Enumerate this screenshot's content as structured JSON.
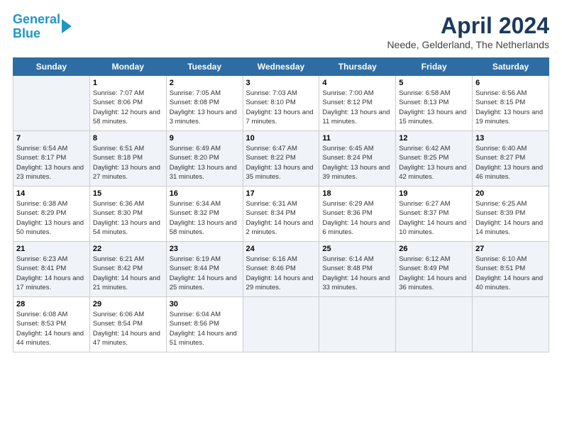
{
  "header": {
    "logo_line1": "General",
    "logo_line2": "Blue",
    "month_title": "April 2024",
    "location": "Neede, Gelderland, The Netherlands"
  },
  "days_of_week": [
    "Sunday",
    "Monday",
    "Tuesday",
    "Wednesday",
    "Thursday",
    "Friday",
    "Saturday"
  ],
  "weeks": [
    [
      {
        "num": "",
        "sunrise": "",
        "sunset": "",
        "daylight": ""
      },
      {
        "num": "1",
        "sunrise": "Sunrise: 7:07 AM",
        "sunset": "Sunset: 8:06 PM",
        "daylight": "Daylight: 12 hours and 58 minutes."
      },
      {
        "num": "2",
        "sunrise": "Sunrise: 7:05 AM",
        "sunset": "Sunset: 8:08 PM",
        "daylight": "Daylight: 13 hours and 3 minutes."
      },
      {
        "num": "3",
        "sunrise": "Sunrise: 7:03 AM",
        "sunset": "Sunset: 8:10 PM",
        "daylight": "Daylight: 13 hours and 7 minutes."
      },
      {
        "num": "4",
        "sunrise": "Sunrise: 7:00 AM",
        "sunset": "Sunset: 8:12 PM",
        "daylight": "Daylight: 13 hours and 11 minutes."
      },
      {
        "num": "5",
        "sunrise": "Sunrise: 6:58 AM",
        "sunset": "Sunset: 8:13 PM",
        "daylight": "Daylight: 13 hours and 15 minutes."
      },
      {
        "num": "6",
        "sunrise": "Sunrise: 6:56 AM",
        "sunset": "Sunset: 8:15 PM",
        "daylight": "Daylight: 13 hours and 19 minutes."
      }
    ],
    [
      {
        "num": "7",
        "sunrise": "Sunrise: 6:54 AM",
        "sunset": "Sunset: 8:17 PM",
        "daylight": "Daylight: 13 hours and 23 minutes."
      },
      {
        "num": "8",
        "sunrise": "Sunrise: 6:51 AM",
        "sunset": "Sunset: 8:18 PM",
        "daylight": "Daylight: 13 hours and 27 minutes."
      },
      {
        "num": "9",
        "sunrise": "Sunrise: 6:49 AM",
        "sunset": "Sunset: 8:20 PM",
        "daylight": "Daylight: 13 hours and 31 minutes."
      },
      {
        "num": "10",
        "sunrise": "Sunrise: 6:47 AM",
        "sunset": "Sunset: 8:22 PM",
        "daylight": "Daylight: 13 hours and 35 minutes."
      },
      {
        "num": "11",
        "sunrise": "Sunrise: 6:45 AM",
        "sunset": "Sunset: 8:24 PM",
        "daylight": "Daylight: 13 hours and 39 minutes."
      },
      {
        "num": "12",
        "sunrise": "Sunrise: 6:42 AM",
        "sunset": "Sunset: 8:25 PM",
        "daylight": "Daylight: 13 hours and 42 minutes."
      },
      {
        "num": "13",
        "sunrise": "Sunrise: 6:40 AM",
        "sunset": "Sunset: 8:27 PM",
        "daylight": "Daylight: 13 hours and 46 minutes."
      }
    ],
    [
      {
        "num": "14",
        "sunrise": "Sunrise: 6:38 AM",
        "sunset": "Sunset: 8:29 PM",
        "daylight": "Daylight: 13 hours and 50 minutes."
      },
      {
        "num": "15",
        "sunrise": "Sunrise: 6:36 AM",
        "sunset": "Sunset: 8:30 PM",
        "daylight": "Daylight: 13 hours and 54 minutes."
      },
      {
        "num": "16",
        "sunrise": "Sunrise: 6:34 AM",
        "sunset": "Sunset: 8:32 PM",
        "daylight": "Daylight: 13 hours and 58 minutes."
      },
      {
        "num": "17",
        "sunrise": "Sunrise: 6:31 AM",
        "sunset": "Sunset: 8:34 PM",
        "daylight": "Daylight: 14 hours and 2 minutes."
      },
      {
        "num": "18",
        "sunrise": "Sunrise: 6:29 AM",
        "sunset": "Sunset: 8:36 PM",
        "daylight": "Daylight: 14 hours and 6 minutes."
      },
      {
        "num": "19",
        "sunrise": "Sunrise: 6:27 AM",
        "sunset": "Sunset: 8:37 PM",
        "daylight": "Daylight: 14 hours and 10 minutes."
      },
      {
        "num": "20",
        "sunrise": "Sunrise: 6:25 AM",
        "sunset": "Sunset: 8:39 PM",
        "daylight": "Daylight: 14 hours and 14 minutes."
      }
    ],
    [
      {
        "num": "21",
        "sunrise": "Sunrise: 6:23 AM",
        "sunset": "Sunset: 8:41 PM",
        "daylight": "Daylight: 14 hours and 17 minutes."
      },
      {
        "num": "22",
        "sunrise": "Sunrise: 6:21 AM",
        "sunset": "Sunset: 8:42 PM",
        "daylight": "Daylight: 14 hours and 21 minutes."
      },
      {
        "num": "23",
        "sunrise": "Sunrise: 6:19 AM",
        "sunset": "Sunset: 8:44 PM",
        "daylight": "Daylight: 14 hours and 25 minutes."
      },
      {
        "num": "24",
        "sunrise": "Sunrise: 6:16 AM",
        "sunset": "Sunset: 8:46 PM",
        "daylight": "Daylight: 14 hours and 29 minutes."
      },
      {
        "num": "25",
        "sunrise": "Sunrise: 6:14 AM",
        "sunset": "Sunset: 8:48 PM",
        "daylight": "Daylight: 14 hours and 33 minutes."
      },
      {
        "num": "26",
        "sunrise": "Sunrise: 6:12 AM",
        "sunset": "Sunset: 8:49 PM",
        "daylight": "Daylight: 14 hours and 36 minutes."
      },
      {
        "num": "27",
        "sunrise": "Sunrise: 6:10 AM",
        "sunset": "Sunset: 8:51 PM",
        "daylight": "Daylight: 14 hours and 40 minutes."
      }
    ],
    [
      {
        "num": "28",
        "sunrise": "Sunrise: 6:08 AM",
        "sunset": "Sunset: 8:53 PM",
        "daylight": "Daylight: 14 hours and 44 minutes."
      },
      {
        "num": "29",
        "sunrise": "Sunrise: 6:06 AM",
        "sunset": "Sunset: 8:54 PM",
        "daylight": "Daylight: 14 hours and 47 minutes."
      },
      {
        "num": "30",
        "sunrise": "Sunrise: 6:04 AM",
        "sunset": "Sunset: 8:56 PM",
        "daylight": "Daylight: 14 hours and 51 minutes."
      },
      {
        "num": "",
        "sunrise": "",
        "sunset": "",
        "daylight": ""
      },
      {
        "num": "",
        "sunrise": "",
        "sunset": "",
        "daylight": ""
      },
      {
        "num": "",
        "sunrise": "",
        "sunset": "",
        "daylight": ""
      },
      {
        "num": "",
        "sunrise": "",
        "sunset": "",
        "daylight": ""
      }
    ]
  ]
}
